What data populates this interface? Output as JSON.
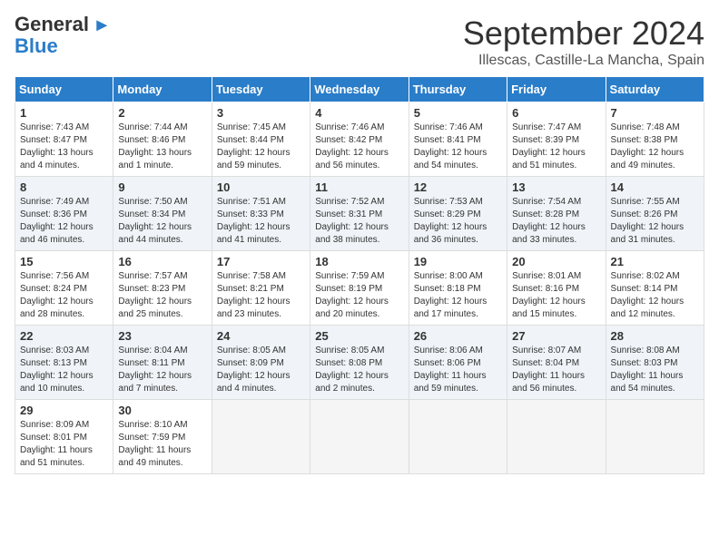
{
  "header": {
    "logo_general": "General",
    "logo_blue": "Blue",
    "month": "September 2024",
    "location": "Illescas, Castille-La Mancha, Spain"
  },
  "weekdays": [
    "Sunday",
    "Monday",
    "Tuesday",
    "Wednesday",
    "Thursday",
    "Friday",
    "Saturday"
  ],
  "weeks": [
    [
      {
        "day": "1",
        "info": "Sunrise: 7:43 AM\nSunset: 8:47 PM\nDaylight: 13 hours and 4 minutes."
      },
      {
        "day": "2",
        "info": "Sunrise: 7:44 AM\nSunset: 8:46 PM\nDaylight: 13 hours and 1 minute."
      },
      {
        "day": "3",
        "info": "Sunrise: 7:45 AM\nSunset: 8:44 PM\nDaylight: 12 hours and 59 minutes."
      },
      {
        "day": "4",
        "info": "Sunrise: 7:46 AM\nSunset: 8:42 PM\nDaylight: 12 hours and 56 minutes."
      },
      {
        "day": "5",
        "info": "Sunrise: 7:46 AM\nSunset: 8:41 PM\nDaylight: 12 hours and 54 minutes."
      },
      {
        "day": "6",
        "info": "Sunrise: 7:47 AM\nSunset: 8:39 PM\nDaylight: 12 hours and 51 minutes."
      },
      {
        "day": "7",
        "info": "Sunrise: 7:48 AM\nSunset: 8:38 PM\nDaylight: 12 hours and 49 minutes."
      }
    ],
    [
      {
        "day": "8",
        "info": "Sunrise: 7:49 AM\nSunset: 8:36 PM\nDaylight: 12 hours and 46 minutes."
      },
      {
        "day": "9",
        "info": "Sunrise: 7:50 AM\nSunset: 8:34 PM\nDaylight: 12 hours and 44 minutes."
      },
      {
        "day": "10",
        "info": "Sunrise: 7:51 AM\nSunset: 8:33 PM\nDaylight: 12 hours and 41 minutes."
      },
      {
        "day": "11",
        "info": "Sunrise: 7:52 AM\nSunset: 8:31 PM\nDaylight: 12 hours and 38 minutes."
      },
      {
        "day": "12",
        "info": "Sunrise: 7:53 AM\nSunset: 8:29 PM\nDaylight: 12 hours and 36 minutes."
      },
      {
        "day": "13",
        "info": "Sunrise: 7:54 AM\nSunset: 8:28 PM\nDaylight: 12 hours and 33 minutes."
      },
      {
        "day": "14",
        "info": "Sunrise: 7:55 AM\nSunset: 8:26 PM\nDaylight: 12 hours and 31 minutes."
      }
    ],
    [
      {
        "day": "15",
        "info": "Sunrise: 7:56 AM\nSunset: 8:24 PM\nDaylight: 12 hours and 28 minutes."
      },
      {
        "day": "16",
        "info": "Sunrise: 7:57 AM\nSunset: 8:23 PM\nDaylight: 12 hours and 25 minutes."
      },
      {
        "day": "17",
        "info": "Sunrise: 7:58 AM\nSunset: 8:21 PM\nDaylight: 12 hours and 23 minutes."
      },
      {
        "day": "18",
        "info": "Sunrise: 7:59 AM\nSunset: 8:19 PM\nDaylight: 12 hours and 20 minutes."
      },
      {
        "day": "19",
        "info": "Sunrise: 8:00 AM\nSunset: 8:18 PM\nDaylight: 12 hours and 17 minutes."
      },
      {
        "day": "20",
        "info": "Sunrise: 8:01 AM\nSunset: 8:16 PM\nDaylight: 12 hours and 15 minutes."
      },
      {
        "day": "21",
        "info": "Sunrise: 8:02 AM\nSunset: 8:14 PM\nDaylight: 12 hours and 12 minutes."
      }
    ],
    [
      {
        "day": "22",
        "info": "Sunrise: 8:03 AM\nSunset: 8:13 PM\nDaylight: 12 hours and 10 minutes."
      },
      {
        "day": "23",
        "info": "Sunrise: 8:04 AM\nSunset: 8:11 PM\nDaylight: 12 hours and 7 minutes."
      },
      {
        "day": "24",
        "info": "Sunrise: 8:05 AM\nSunset: 8:09 PM\nDaylight: 12 hours and 4 minutes."
      },
      {
        "day": "25",
        "info": "Sunrise: 8:05 AM\nSunset: 8:08 PM\nDaylight: 12 hours and 2 minutes."
      },
      {
        "day": "26",
        "info": "Sunrise: 8:06 AM\nSunset: 8:06 PM\nDaylight: 11 hours and 59 minutes."
      },
      {
        "day": "27",
        "info": "Sunrise: 8:07 AM\nSunset: 8:04 PM\nDaylight: 11 hours and 56 minutes."
      },
      {
        "day": "28",
        "info": "Sunrise: 8:08 AM\nSunset: 8:03 PM\nDaylight: 11 hours and 54 minutes."
      }
    ],
    [
      {
        "day": "29",
        "info": "Sunrise: 8:09 AM\nSunset: 8:01 PM\nDaylight: 11 hours and 51 minutes."
      },
      {
        "day": "30",
        "info": "Sunrise: 8:10 AM\nSunset: 7:59 PM\nDaylight: 11 hours and 49 minutes."
      },
      null,
      null,
      null,
      null,
      null
    ]
  ]
}
